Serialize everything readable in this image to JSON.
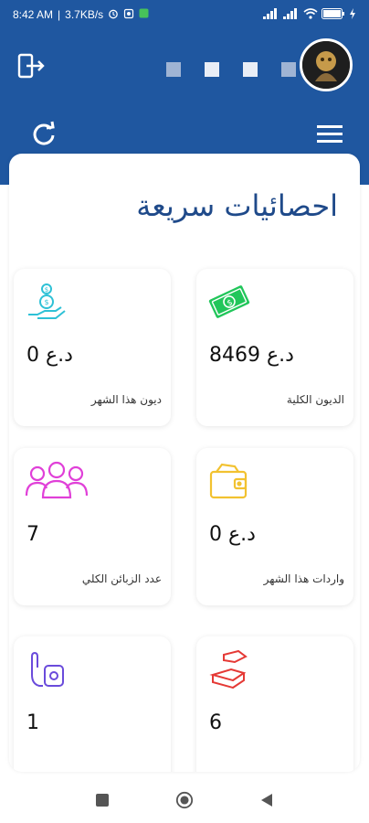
{
  "status_bar": {
    "time": "8:42 AM",
    "speed": "3.7KB/s",
    "battery": "88"
  },
  "header": {
    "refresh_icon": "refresh-icon",
    "menu_icon": "hamburger-menu-icon",
    "exit_icon": "logout-icon"
  },
  "panel": {
    "title": "احصائيات سريعة"
  },
  "cards": [
    {
      "value": "8469 د.ع",
      "label": "الديون الكلية",
      "icon": "money-bill-icon",
      "color": "#21c65a"
    },
    {
      "value": "0 د.ع",
      "label": "ديون هذا الشهر",
      "icon": "money-hand-icon",
      "color": "#2ec1d6"
    },
    {
      "value": "0 د.ع",
      "label": "واردات هذا الشهر",
      "icon": "wallet-icon",
      "color": "#f2c230"
    },
    {
      "value": "7",
      "label": "عدد الزبائن الكلي",
      "icon": "users-icon",
      "color": "#e040d8"
    },
    {
      "value": "6",
      "label": "",
      "icon": "payment-hand-icon",
      "color": "#e53935"
    },
    {
      "value": "1",
      "label": "",
      "icon": "stop-hand-icon",
      "color": "#6a4bdb"
    }
  ],
  "colors": {
    "header_bg": "#1f57a0",
    "title": "#1f4a8a"
  }
}
